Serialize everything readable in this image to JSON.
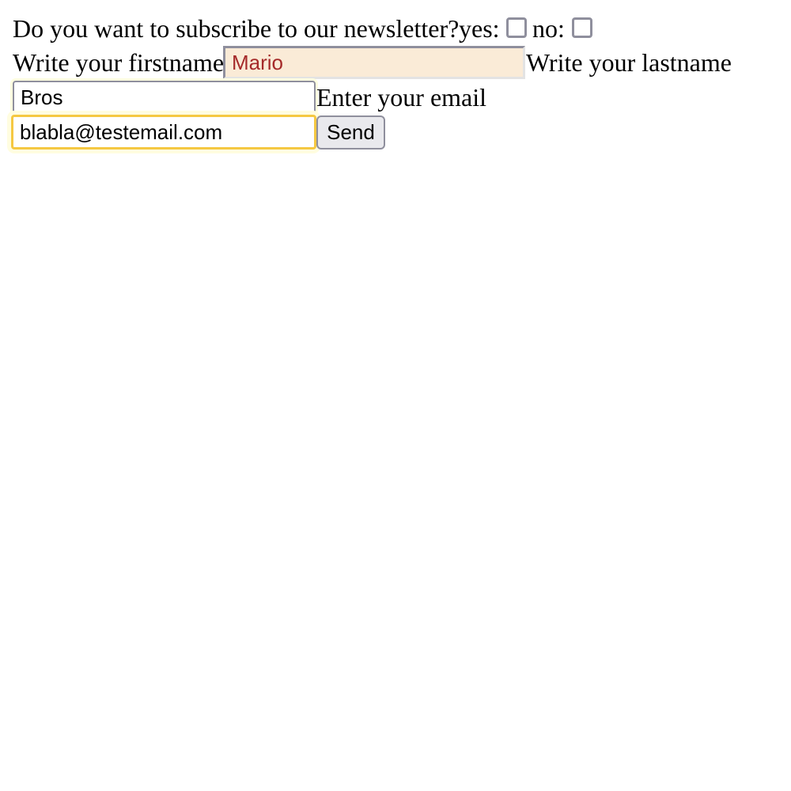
{
  "form": {
    "newsletter_question": "Do you want to subscribe to our newsletter?",
    "yes_label": "yes:",
    "no_label": "no:",
    "firstname_label": "Write your firstname",
    "firstname_value": "Mario",
    "lastname_label": "Write your lastname",
    "lastname_value": "Bros",
    "email_label": "Enter your email",
    "email_value": "blabla@testemail.com",
    "send_label": "Send"
  },
  "colors": {
    "firstname_background": "#faebd7",
    "firstname_text": "#a52a2a",
    "email_focus_border": "#f5c842",
    "button_background": "#e9e9ed"
  }
}
